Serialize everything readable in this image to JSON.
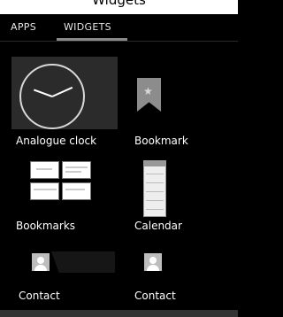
{
  "header": {
    "title": "Widgets"
  },
  "tabs": [
    {
      "label": "APPS"
    },
    {
      "label": "WIDGETS"
    }
  ],
  "widgets": [
    {
      "label": "Analogue clock",
      "icon": "analog-clock-icon"
    },
    {
      "label": "Bookmark",
      "icon": "bookmark-icon"
    },
    {
      "label": "Bookmarks",
      "icon": "bookmarks-thumbnails"
    },
    {
      "label": "Calendar",
      "icon": "calendar-icon"
    },
    {
      "label": "Contact",
      "icon": "contact-avatar-icon"
    },
    {
      "label": "Contact",
      "icon": "contact-avatar-icon"
    }
  ]
}
